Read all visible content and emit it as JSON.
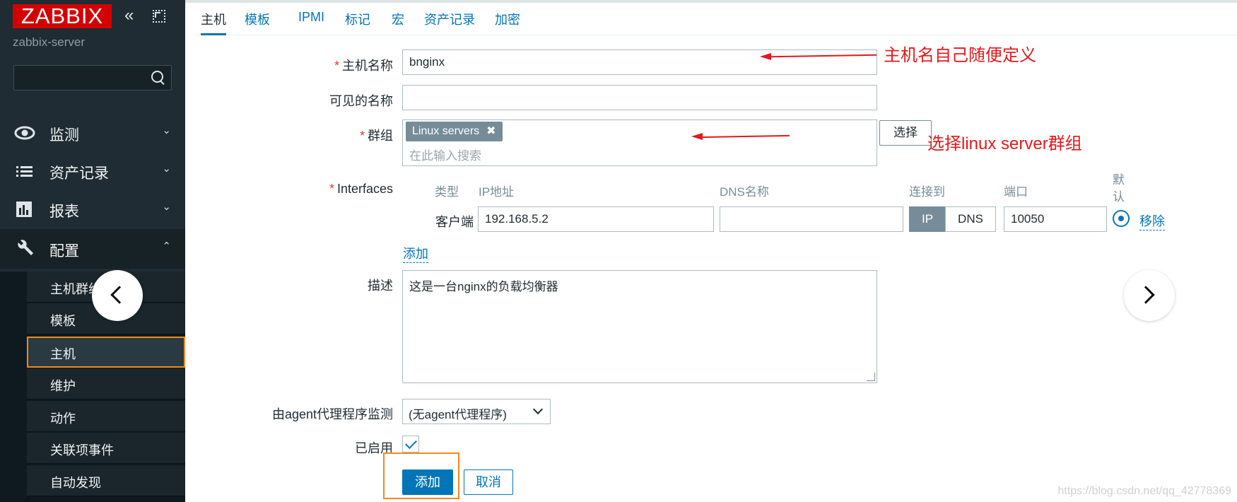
{
  "sidebar": {
    "logo": "ZABBIX",
    "server_name": "zabbix-server",
    "search_placeholder": "",
    "nav": [
      {
        "label": "监测",
        "icon": "eye-icon"
      },
      {
        "label": "资产记录",
        "icon": "list-icon"
      },
      {
        "label": "报表",
        "icon": "bar-chart-icon"
      },
      {
        "label": "配置",
        "icon": "wrench-icon"
      }
    ],
    "sub_items": [
      "主机群组",
      "模板",
      "主机",
      "维护",
      "动作",
      "关联项事件",
      "自动发现"
    ]
  },
  "tabs": [
    "主机",
    "模板",
    "IPMI",
    "标记",
    "宏",
    "资产记录",
    "加密"
  ],
  "form": {
    "hostname_label": "主机名称",
    "hostname_value": "bnginx",
    "visible_name_label": "可见的名称",
    "visible_name_value": "",
    "groups_label": "群组",
    "group_tag": "Linux servers",
    "group_search_placeholder": "在此输入搜索",
    "select_button": "选择",
    "interfaces_label": "Interfaces",
    "iface_headers": {
      "type": "类型",
      "ip": "IP地址",
      "dns": "DNS名称",
      "connect": "连接到",
      "port": "端口",
      "default": "默认"
    },
    "iface_row": {
      "type": "客户端",
      "ip": "192.168.5.2",
      "dns": "",
      "connect_ip": "IP",
      "connect_dns": "DNS",
      "port": "10050",
      "remove": "移除"
    },
    "add_link": "添加",
    "description_label": "描述",
    "description_value": "这是一台nginx的负载均衡器",
    "proxy_label": "由agent代理程序监测",
    "proxy_value": "(无agent代理程序)",
    "enabled_label": "已启用",
    "add_button": "添加",
    "cancel_button": "取消"
  },
  "annotations": {
    "hostname_note": "主机名自己随便定义",
    "group_note": "选择linux server群组"
  },
  "watermark": "https://blog.csdn.net/qq_42778369",
  "colors": {
    "accent": "#0275b8",
    "annotation": "#e3191b",
    "highlight": "#f28a1b",
    "sidebar": "#1f2c33",
    "logo": "#d40000"
  }
}
